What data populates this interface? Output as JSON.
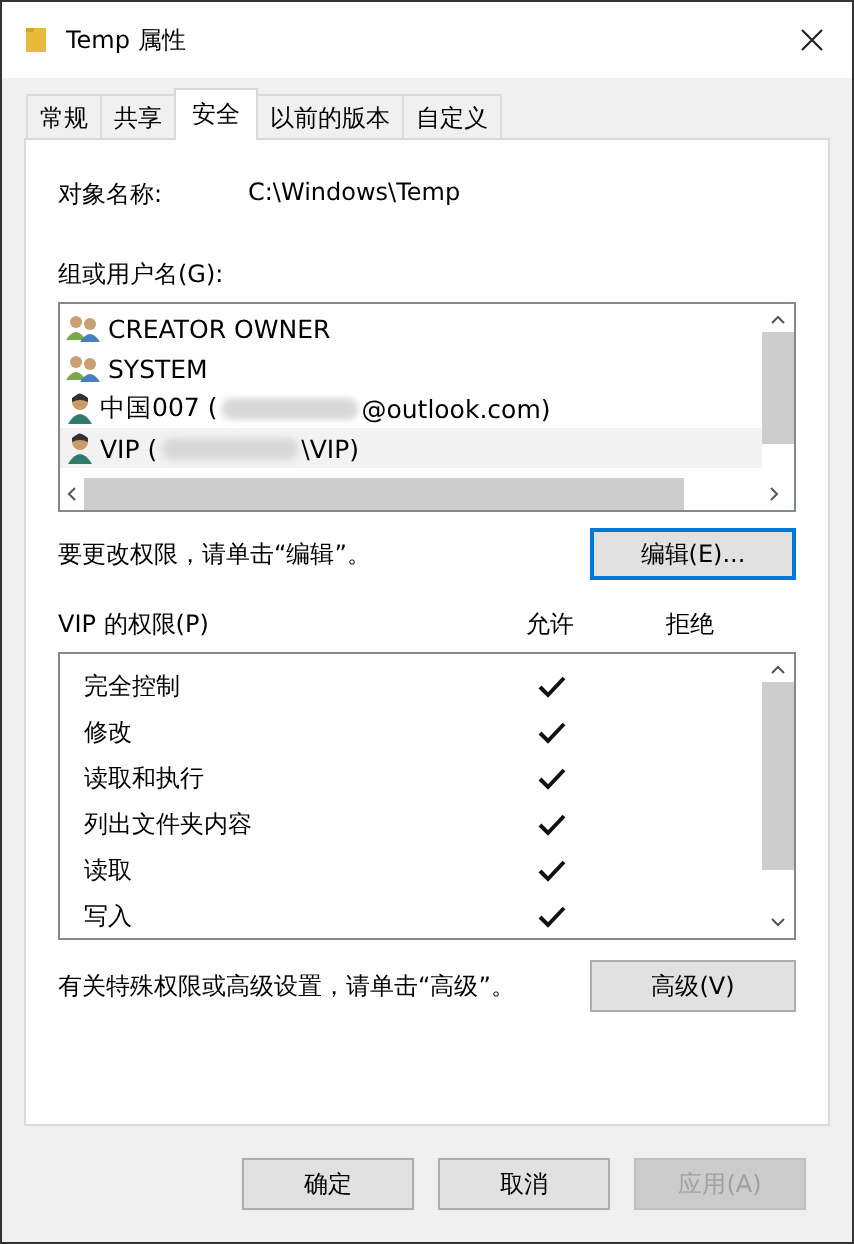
{
  "window": {
    "title": "Temp 属性"
  },
  "tabs": [
    {
      "label": "常规",
      "selected": false
    },
    {
      "label": "共享",
      "selected": false
    },
    {
      "label": "安全",
      "selected": true
    },
    {
      "label": "以前的版本",
      "selected": false
    },
    {
      "label": "自定义",
      "selected": false
    }
  ],
  "object_name": {
    "label": "对象名称:",
    "value": "C:\\Windows\\Temp"
  },
  "users": {
    "label": "组或用户名(G):",
    "items": [
      {
        "kind": "group",
        "prefix": "CREATOR OWNER",
        "redacted": false,
        "selected": false
      },
      {
        "kind": "group",
        "prefix": "SYSTEM",
        "redacted": false,
        "selected": false
      },
      {
        "kind": "user",
        "prefix": "中国007 (",
        "redacted": true,
        "suffix": "@outlook.com)",
        "selected": false
      },
      {
        "kind": "user",
        "prefix": "VIP (",
        "redacted": true,
        "suffix": "\\VIP)",
        "selected": true
      }
    ]
  },
  "edit_hint": "要更改权限，请单击“编辑”。",
  "edit_button": "编辑(E)...",
  "permissions": {
    "label": "VIP 的权限(P)",
    "allow_header": "允许",
    "deny_header": "拒绝",
    "rows": [
      {
        "name": "完全控制",
        "allow": true,
        "deny": false
      },
      {
        "name": "修改",
        "allow": true,
        "deny": false
      },
      {
        "name": "读取和执行",
        "allow": true,
        "deny": false
      },
      {
        "name": "列出文件夹内容",
        "allow": true,
        "deny": false
      },
      {
        "name": "读取",
        "allow": true,
        "deny": false
      },
      {
        "name": "写入",
        "allow": true,
        "deny": false
      }
    ]
  },
  "advanced_hint": "有关特殊权限或高级设置，请单击“高级”。",
  "advanced_button": "高级(V)",
  "buttons": [
    {
      "label": "确定",
      "disabled": false
    },
    {
      "label": "取消",
      "disabled": false
    },
    {
      "label": "应用(A)",
      "disabled": true
    }
  ]
}
